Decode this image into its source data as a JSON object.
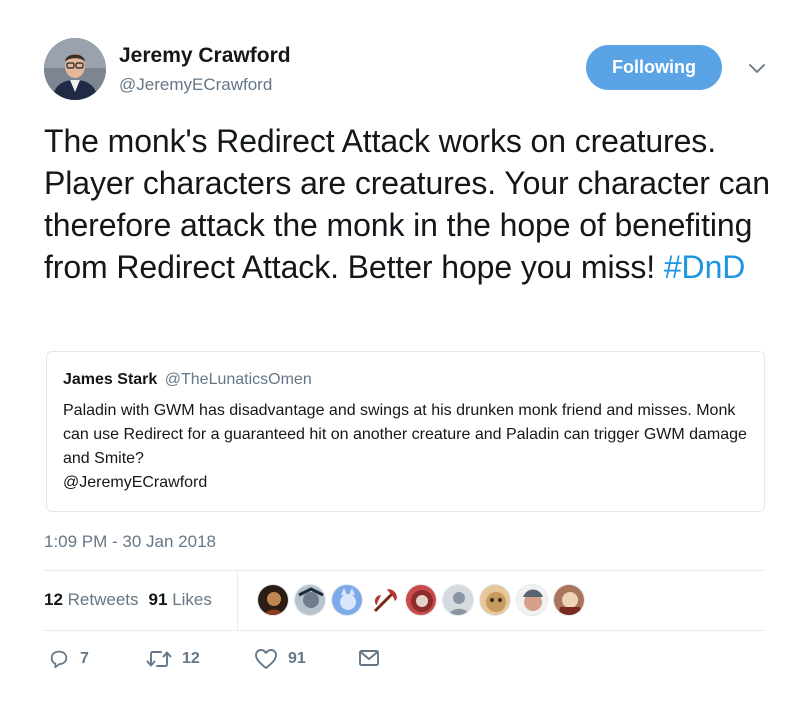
{
  "tweet": {
    "author": {
      "name": "Jeremy Crawford",
      "handle": "@JeremyECrawford"
    },
    "follow_button": "Following",
    "text": "The monk's Redirect Attack works on creatures. Player characters are creatures. Your character can therefore attack the monk in the hope of benefiting from Redirect Attack. Better hope you miss! ",
    "hashtag": "#DnD",
    "quoted": {
      "name": "James Stark",
      "handle": "@TheLunaticsOmen",
      "text": "Paladin with GWM has disadvantage and swings at his drunken monk friend and misses. Monk can use Redirect for a guaranteed hit on another creature and Paladin can trigger GWM damage and Smite?",
      "mention": "@JeremyECrawford"
    },
    "timestamp": "1:09 PM - 30 Jan 2018",
    "stats": {
      "retweets_count": "12",
      "retweets_label": "Retweets",
      "likes_count": "91",
      "likes_label": "Likes"
    },
    "likers_count": 9,
    "actions": {
      "replies": "7",
      "retweets": "12",
      "likes": "91"
    }
  },
  "colors": {
    "follow_button": "#5aa4e6",
    "hashtag": "#1b95e0",
    "secondary_text": "#657786",
    "primary_text": "#14171a"
  },
  "icons": [
    "chevron-down-icon",
    "reply-icon",
    "retweet-icon",
    "heart-icon",
    "mail-icon"
  ]
}
